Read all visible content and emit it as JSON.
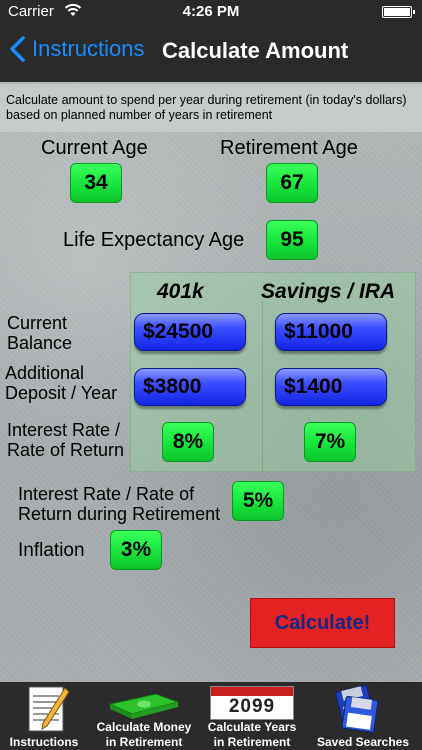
{
  "status": {
    "carrier": "Carrier",
    "time": "4:26 PM"
  },
  "nav": {
    "back_label": "Instructions",
    "title": "Calculate Amount"
  },
  "description": {
    "line1": "Calculate amount to spend per year during retirement (in today's dollars)",
    "line2": "based on planned number of years in retirement"
  },
  "ages": {
    "current_label": "Current Age",
    "current_value": "34",
    "retirement_label": "Retirement Age",
    "retirement_value": "67",
    "life_label": "Life Expectancy Age",
    "life_value": "95"
  },
  "columns": {
    "col1": "401k",
    "col2": "Savings / IRA"
  },
  "rows": {
    "balance_label_1": "Current",
    "balance_label_2": "Balance",
    "balance_401k": "$24500",
    "balance_savings": "$11000",
    "deposit_label_1": "Additional",
    "deposit_label_2": "Deposit / Year",
    "deposit_401k": "$3800",
    "deposit_savings": "$1400",
    "rate_label_1": "Interest Rate /",
    "rate_label_2": "Rate of Return",
    "rate_401k": "8%",
    "rate_savings": "7%"
  },
  "retirement_rate": {
    "label_1": "Interest Rate / Rate of",
    "label_2": "Return during Retirement",
    "value": "5%"
  },
  "inflation": {
    "label": "Inflation",
    "value": "3%"
  },
  "calculate_label": "Calculate!",
  "tabs": [
    {
      "label_1": "Instructions",
      "label_2": ""
    },
    {
      "label_1": "Calculate Money",
      "label_2": "in Retirement"
    },
    {
      "label_1": "Calculate Years",
      "label_2": "in Retirement",
      "icon_text": "2099"
    },
    {
      "label_1": "Saved Searches",
      "label_2": ""
    }
  ],
  "colors": {
    "accent": "#1a8cff",
    "green": "#16e53a",
    "blue": "#1325e6",
    "red": "#e52222"
  }
}
